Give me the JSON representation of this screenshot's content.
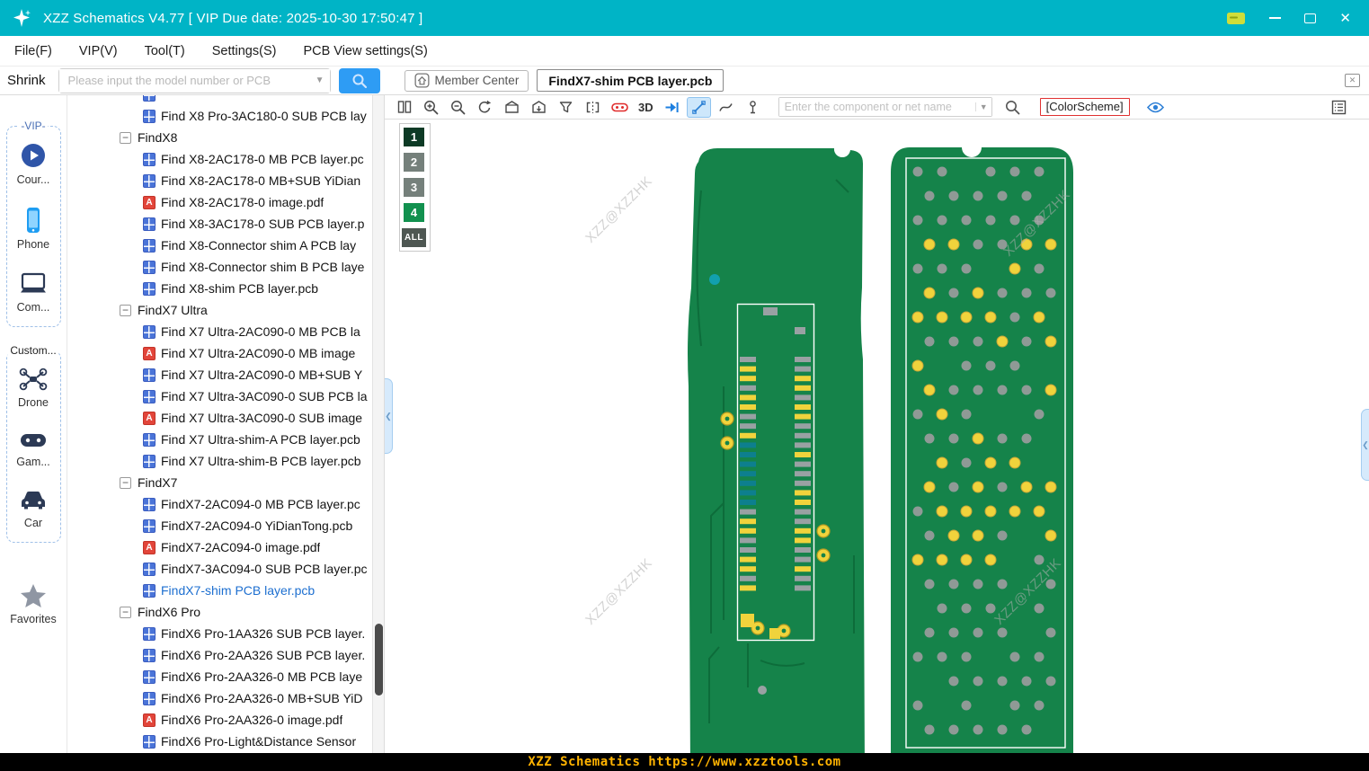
{
  "window": {
    "title": "XZZ Schematics V4.77 [ VIP Due date: 2025-10-30 17:50:47 ]"
  },
  "menu": {
    "items": [
      {
        "id": "file",
        "label": "File(F)"
      },
      {
        "id": "vip",
        "label": "VIP(V)"
      },
      {
        "id": "tool",
        "label": "Tool(T)"
      },
      {
        "id": "settings",
        "label": "Settings(S)"
      },
      {
        "id": "pcb-view-settings",
        "label": "PCB View settings(S)"
      }
    ]
  },
  "topbar": {
    "shrink_label": "Shrink",
    "search_placeholder": "Please input the model number or PCB",
    "member_center_label": "Member Center",
    "tab_label": "FindX7-shim PCB layer.pcb"
  },
  "sidebar": {
    "vip_title": "-VIP-",
    "course_label": "Cour...",
    "phone_label": "Phone",
    "computer_label": "Com...",
    "custom_title": "Custom...",
    "drone_label": "Drone",
    "game_label": "Gam...",
    "car_label": "Car",
    "favorites_label": "Favorites"
  },
  "tree": {
    "items": [
      {
        "type": "file",
        "icon": "pcb",
        "label": ""
      },
      {
        "type": "file",
        "icon": "pcb",
        "label": "Find X8 Pro-3AC180-0 SUB PCB lay"
      },
      {
        "type": "group",
        "label": "FindX8"
      },
      {
        "type": "file",
        "icon": "pcb",
        "label": "Find X8-2AC178-0 MB PCB layer.pc"
      },
      {
        "type": "file",
        "icon": "pcb",
        "label": "Find X8-2AC178-0 MB+SUB YiDian"
      },
      {
        "type": "file",
        "icon": "pdf",
        "label": "Find X8-2AC178-0 image.pdf"
      },
      {
        "type": "file",
        "icon": "pcb",
        "label": "Find X8-3AC178-0 SUB PCB layer.p"
      },
      {
        "type": "file",
        "icon": "pcb",
        "label": "Find X8-Connector shim A PCB lay"
      },
      {
        "type": "file",
        "icon": "pcb",
        "label": "Find X8-Connector shim B PCB laye"
      },
      {
        "type": "file",
        "icon": "pcb",
        "label": "Find X8-shim PCB layer.pcb"
      },
      {
        "type": "group",
        "label": "FindX7 Ultra"
      },
      {
        "type": "file",
        "icon": "pcb",
        "label": "Find X7 Ultra-2AC090-0 MB PCB la"
      },
      {
        "type": "file",
        "icon": "pdf",
        "label": "Find X7 Ultra-2AC090-0 MB image"
      },
      {
        "type": "file",
        "icon": "pcb",
        "label": "Find X7 Ultra-2AC090-0 MB+SUB Y"
      },
      {
        "type": "file",
        "icon": "pcb",
        "label": "Find X7 Ultra-3AC090-0 SUB PCB la"
      },
      {
        "type": "file",
        "icon": "pdf",
        "label": "Find X7 Ultra-3AC090-0 SUB image"
      },
      {
        "type": "file",
        "icon": "pcb",
        "label": "Find X7 Ultra-shim-A PCB layer.pcb"
      },
      {
        "type": "file",
        "icon": "pcb",
        "label": "Find X7 Ultra-shim-B PCB layer.pcb"
      },
      {
        "type": "group",
        "label": "FindX7"
      },
      {
        "type": "file",
        "icon": "pcb",
        "label": "FindX7-2AC094-0 MB PCB layer.pc"
      },
      {
        "type": "file",
        "icon": "pcb",
        "label": "FindX7-2AC094-0 YiDianTong.pcb"
      },
      {
        "type": "file",
        "icon": "pdf",
        "label": "FindX7-2AC094-0 image.pdf"
      },
      {
        "type": "file",
        "icon": "pcb",
        "label": "FindX7-3AC094-0 SUB PCB layer.pc"
      },
      {
        "type": "file",
        "icon": "pcb",
        "label": "FindX7-shim PCB layer.pcb",
        "selected": true
      },
      {
        "type": "group",
        "label": "FindX6 Pro"
      },
      {
        "type": "file",
        "icon": "pcb",
        "label": "FindX6 Pro-1AA326 SUB PCB layer."
      },
      {
        "type": "file",
        "icon": "pcb",
        "label": "FindX6 Pro-2AA326 SUB PCB layer."
      },
      {
        "type": "file",
        "icon": "pcb",
        "label": "FindX6 Pro-2AA326-0 MB PCB laye"
      },
      {
        "type": "file",
        "icon": "pcb",
        "label": "FindX6 Pro-2AA326-0 MB+SUB YiD"
      },
      {
        "type": "file",
        "icon": "pdf",
        "label": "FindX6 Pro-2AA326-0 image.pdf"
      },
      {
        "type": "file",
        "icon": "pcb",
        "label": "FindX6 Pro-Light&Distance Sensor"
      }
    ]
  },
  "pcbbar": {
    "threeD_label": "3D",
    "colorscheme_label": "[ColorScheme]",
    "search_placeholder": "Enter the component or net name",
    "icons": [
      "split-view",
      "zoom-in",
      "zoom-out",
      "rotate",
      "board-top",
      "board-bottom",
      "fill",
      "mirror",
      "board-view-red",
      "3d",
      "jump-arrow",
      "measure",
      "curve",
      "probe",
      "component-search",
      "magnifier",
      "colorscheme",
      "visibility-eye",
      "layers-panel"
    ]
  },
  "layers": {
    "buttons": [
      {
        "label": "1",
        "color": "#0d3a25",
        "selected": true
      },
      {
        "label": "2",
        "color": "#75807b",
        "selected": false
      },
      {
        "label": "3",
        "color": "#75807b",
        "selected": false
      },
      {
        "label": "4",
        "color": "#12914f",
        "selected": false
      },
      {
        "label": "ALL",
        "color": "#4e5752",
        "selected": false
      }
    ]
  },
  "canvas": {
    "watermark": "XZZ@XZZHK"
  },
  "statusbar": {
    "text": "XZZ Schematics https://www.xzztools.com"
  },
  "colors": {
    "titlebar": "#00b4c6",
    "accent_blue": "#2e9cf4",
    "pcb_green": "#15834a",
    "pad_gray": "#99a1a3",
    "pad_yellow": "#f0d33c",
    "pad_teal": "#0d7f8e",
    "status_text": "#ffb300",
    "colorscheme_border": "#e03131"
  }
}
